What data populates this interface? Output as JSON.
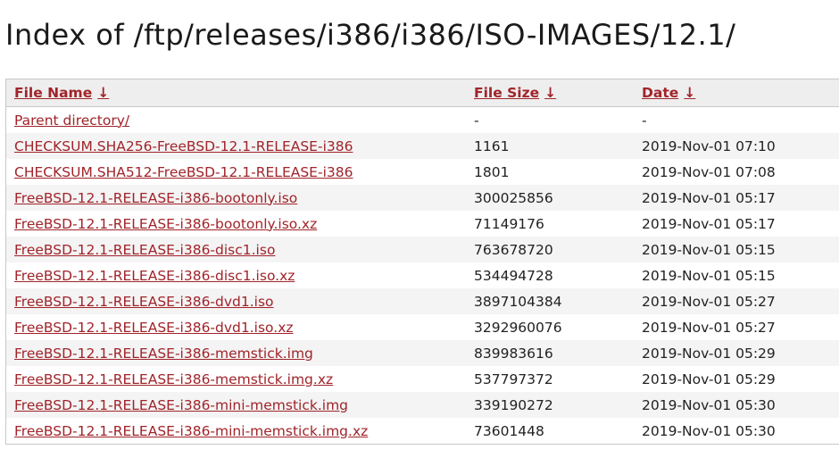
{
  "page": {
    "title": "Index of /ftp/releases/i386/i386/ISO-IMAGES/12.1/"
  },
  "columns": {
    "name": "File Name",
    "size": "File Size",
    "date": "Date",
    "sort_icon": "down-arrow-icon"
  },
  "colors": {
    "link": "#a0242a",
    "header_bg": "#eeeeee",
    "stripe_bg": "#f4f4f4"
  },
  "rows": [
    {
      "name": "Parent directory/",
      "size": "-",
      "date": "-"
    },
    {
      "name": "CHECKSUM.SHA256-FreeBSD-12.1-RELEASE-i386",
      "size": "1161",
      "date": "2019-Nov-01 07:10"
    },
    {
      "name": "CHECKSUM.SHA512-FreeBSD-12.1-RELEASE-i386",
      "size": "1801",
      "date": "2019-Nov-01 07:08"
    },
    {
      "name": "FreeBSD-12.1-RELEASE-i386-bootonly.iso",
      "size": "300025856",
      "date": "2019-Nov-01 05:17"
    },
    {
      "name": "FreeBSD-12.1-RELEASE-i386-bootonly.iso.xz",
      "size": "71149176",
      "date": "2019-Nov-01 05:17"
    },
    {
      "name": "FreeBSD-12.1-RELEASE-i386-disc1.iso",
      "size": "763678720",
      "date": "2019-Nov-01 05:15"
    },
    {
      "name": "FreeBSD-12.1-RELEASE-i386-disc1.iso.xz",
      "size": "534494728",
      "date": "2019-Nov-01 05:15"
    },
    {
      "name": "FreeBSD-12.1-RELEASE-i386-dvd1.iso",
      "size": "3897104384",
      "date": "2019-Nov-01 05:27"
    },
    {
      "name": "FreeBSD-12.1-RELEASE-i386-dvd1.iso.xz",
      "size": "3292960076",
      "date": "2019-Nov-01 05:27"
    },
    {
      "name": "FreeBSD-12.1-RELEASE-i386-memstick.img",
      "size": "839983616",
      "date": "2019-Nov-01 05:29"
    },
    {
      "name": "FreeBSD-12.1-RELEASE-i386-memstick.img.xz",
      "size": "537797372",
      "date": "2019-Nov-01 05:29"
    },
    {
      "name": "FreeBSD-12.1-RELEASE-i386-mini-memstick.img",
      "size": "339190272",
      "date": "2019-Nov-01 05:30"
    },
    {
      "name": "FreeBSD-12.1-RELEASE-i386-mini-memstick.img.xz",
      "size": "73601448",
      "date": "2019-Nov-01 05:30"
    }
  ]
}
